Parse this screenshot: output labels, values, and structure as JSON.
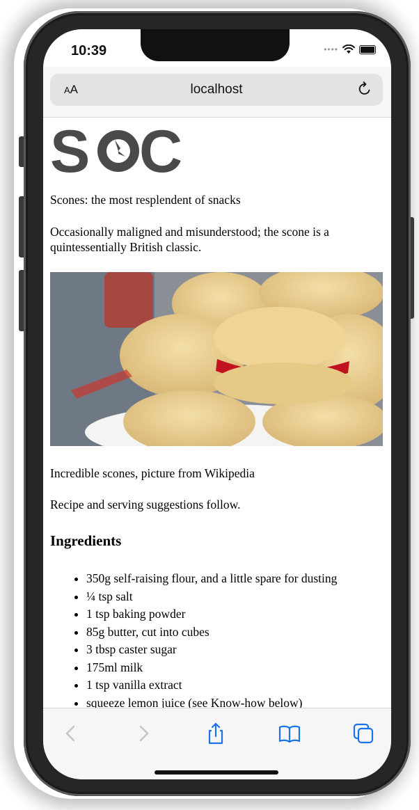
{
  "status_bar": {
    "time": "10:39"
  },
  "browser": {
    "text_size_label_small": "A",
    "text_size_label_large": "A",
    "url": "localhost"
  },
  "page": {
    "logo_text": "SOC",
    "tagline": "Scones: the most resplendent of snacks",
    "intro": "Occasionally maligned and misunderstood; the scone is a quintessentially British classic.",
    "caption": "Incredible scones, picture from Wikipedia",
    "lead": "Recipe and serving suggestions follow.",
    "ingredients_heading": "Ingredients",
    "ingredients": [
      "350g self-raising flour, and a little spare for dusting",
      "¼ tsp salt",
      "1 tsp baking powder",
      "85g butter, cut into cubes",
      "3 tbsp caster sugar",
      "175ml milk",
      "1 tsp vanilla extract",
      "squeeze lemon juice (see Know-how below)"
    ]
  },
  "toolbar": {
    "icons": [
      "back-icon",
      "forward-icon",
      "share-icon",
      "bookmarks-icon",
      "tabs-icon"
    ]
  },
  "colors": {
    "accent": "#1a73e8",
    "logo": "#4a4a4a",
    "disabled": "#c4c4c4"
  }
}
